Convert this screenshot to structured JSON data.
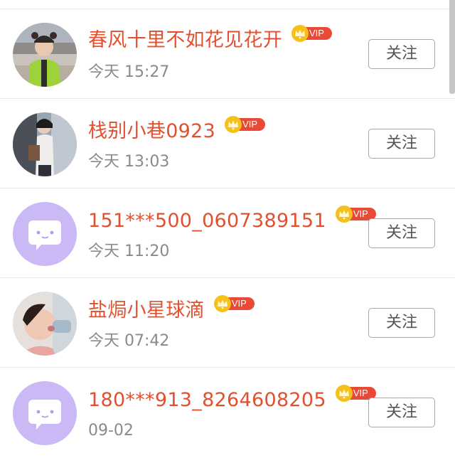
{
  "follow_label": "关注",
  "vip_label": "VIP",
  "colors": {
    "name": "#e2502f",
    "vip_badge": "#ea4a35",
    "crown": "#f5c01a",
    "time": "#8a8a8a",
    "default_avatar_bg": "#cbb9f5"
  },
  "users": [
    {
      "name": "春风十里不如花见花开",
      "time": "今天 15:27",
      "avatar": "photo-avatar",
      "vip": true
    },
    {
      "name": "栈别小巷0923",
      "time": "今天 13:03",
      "avatar": "photo-avatar",
      "vip": true
    },
    {
      "name": "151***500_0607389151",
      "time": "今天 11:20",
      "avatar": "default-chat-avatar",
      "vip": true
    },
    {
      "name": "盐焗小星球滴",
      "time": "今天 07:42",
      "avatar": "photo-avatar",
      "vip": true
    },
    {
      "name": "180***913_8264608205",
      "time": "09-02",
      "avatar": "default-chat-avatar",
      "vip": true
    }
  ]
}
